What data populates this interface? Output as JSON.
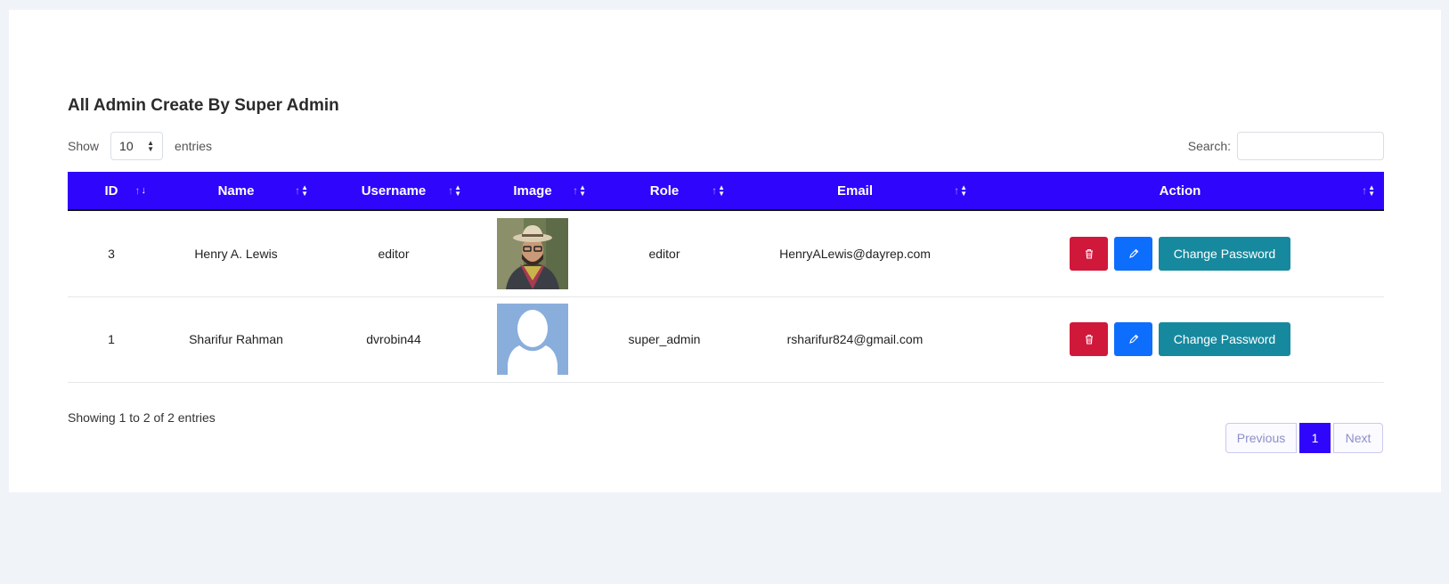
{
  "title": "All Admin Create By Super Admin",
  "length": {
    "show": "Show",
    "value": "10",
    "entries": "entries"
  },
  "search": {
    "label": "Search:",
    "value": ""
  },
  "columns": [
    "ID",
    "Name",
    "Username",
    "Image",
    "Role",
    "Email",
    "Action"
  ],
  "rows": [
    {
      "id": "3",
      "name": "Henry A. Lewis",
      "username": "editor",
      "image": "profile-photo",
      "role": "editor",
      "email": "HenryALewis@dayrep.com"
    },
    {
      "id": "1",
      "name": "Sharifur Rahman",
      "username": "dvrobin44",
      "image": "avatar-placeholder",
      "role": "super_admin",
      "email": "rsharifur824@gmail.com"
    }
  ],
  "action_labels": {
    "change_password": "Change Password"
  },
  "icons": {
    "delete": "trash-icon",
    "edit": "pencil-icon",
    "sort": "sort-icon"
  },
  "info": "Showing 1 to 2 of 2 entries",
  "pagination": {
    "previous": "Previous",
    "current": "1",
    "next": "Next"
  },
  "colors": {
    "header": "#2f05fb",
    "delete": "#d0183b",
    "edit": "#0d6efd",
    "change_password": "#17899e"
  }
}
